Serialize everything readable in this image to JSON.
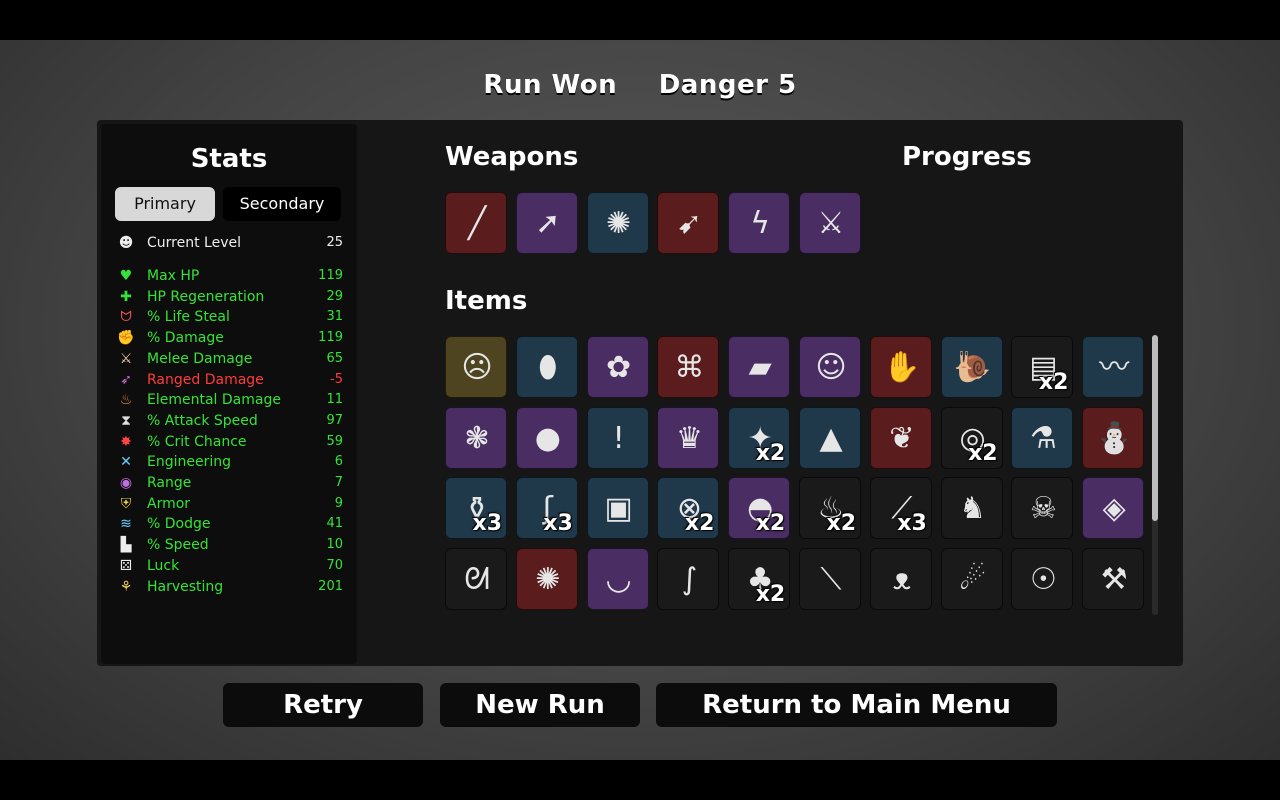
{
  "header": {
    "status": "Run Won",
    "danger": "Danger 5"
  },
  "stats": {
    "title": "Stats",
    "tabs": {
      "primary": "Primary",
      "secondary": "Secondary"
    },
    "level": {
      "label": "Current Level",
      "value": "25"
    },
    "rows": [
      {
        "label": "Max HP",
        "value": "119",
        "color": "#37e237",
        "icon": "heart-icon"
      },
      {
        "label": "HP Regeneration",
        "value": "29",
        "color": "#37e237",
        "icon": "heart-plus-icon"
      },
      {
        "label": "% Life Steal",
        "value": "31",
        "color": "#37e237",
        "icon": "fangs-icon"
      },
      {
        "label": "% Damage",
        "value": "119",
        "color": "#37e237",
        "icon": "muscle-icon"
      },
      {
        "label": "Melee Damage",
        "value": "65",
        "color": "#37e237",
        "icon": "sword-icon"
      },
      {
        "label": "Ranged Damage",
        "value": "-5",
        "color": "#ff3c3c",
        "icon": "bow-icon"
      },
      {
        "label": "Elemental Damage",
        "value": "11",
        "color": "#37e237",
        "icon": "flame-icon"
      },
      {
        "label": "% Attack Speed",
        "value": "97",
        "color": "#37e237",
        "icon": "hourglass-icon"
      },
      {
        "label": "% Crit Chance",
        "value": "59",
        "color": "#37e237",
        "icon": "crit-star-icon"
      },
      {
        "label": "Engineering",
        "value": "6",
        "color": "#37e237",
        "icon": "wrench-icon"
      },
      {
        "label": "Range",
        "value": "7",
        "color": "#37e237",
        "icon": "range-icon"
      },
      {
        "label": "Armor",
        "value": "9",
        "color": "#37e237",
        "icon": "shield-icon"
      },
      {
        "label": "% Dodge",
        "value": "41",
        "color": "#37e237",
        "icon": "dodge-icon"
      },
      {
        "label": "% Speed",
        "value": "10",
        "color": "#37e237",
        "icon": "boot-icon"
      },
      {
        "label": "Luck",
        "value": "70",
        "color": "#37e237",
        "icon": "dice-icon"
      },
      {
        "label": "Harvesting",
        "value": "201",
        "color": "#37e237",
        "icon": "wheat-icon"
      }
    ]
  },
  "weapons": {
    "title": "Weapons",
    "slots": [
      {
        "icon": "stick-icon",
        "tier": "red"
      },
      {
        "icon": "spear-icon",
        "tier": "purple"
      },
      {
        "icon": "saw-icon",
        "tier": "blue"
      },
      {
        "icon": "drill-spear-icon",
        "tier": "red"
      },
      {
        "icon": "lightning-spear-icon",
        "tier": "purple"
      },
      {
        "icon": "sword-icon",
        "tier": "purple"
      }
    ]
  },
  "progress": {
    "title": "Progress"
  },
  "items": {
    "title": "Items",
    "slots": [
      {
        "icon": "egg-face-icon",
        "tier": "gold",
        "count": ""
      },
      {
        "icon": "stone-icon",
        "tier": "blue",
        "count": ""
      },
      {
        "icon": "alien-fly-icon",
        "tier": "purple",
        "count": ""
      },
      {
        "icon": "robot-legs-icon",
        "tier": "red",
        "count": ""
      },
      {
        "icon": "eraser-icon",
        "tier": "purple",
        "count": ""
      },
      {
        "icon": "cat-icon",
        "tier": "purple",
        "count": ""
      },
      {
        "icon": "claw-icon",
        "tier": "red",
        "count": ""
      },
      {
        "icon": "snail-icon",
        "tier": "blue",
        "count": ""
      },
      {
        "icon": "scroll-icon",
        "tier": "black",
        "count": "x2"
      },
      {
        "icon": "leech-icon",
        "tier": "blue",
        "count": ""
      },
      {
        "icon": "peacock-icon",
        "tier": "purple",
        "count": ""
      },
      {
        "icon": "tomato-icon",
        "tier": "purple",
        "count": ""
      },
      {
        "icon": "alert-slime-icon",
        "tier": "blue",
        "count": ""
      },
      {
        "icon": "crown-icon",
        "tier": "purple",
        "count": ""
      },
      {
        "icon": "shard-icon",
        "tier": "blue",
        "count": "x2"
      },
      {
        "icon": "bullet-icon",
        "tier": "blue",
        "count": ""
      },
      {
        "icon": "rainbow-leaf-icon",
        "tier": "red",
        "count": ""
      },
      {
        "icon": "ring-icon",
        "tier": "black",
        "count": "x2"
      },
      {
        "icon": "potion-icon",
        "tier": "blue",
        "count": ""
      },
      {
        "icon": "gnome-icon",
        "tier": "red",
        "count": ""
      },
      {
        "icon": "green-potion-icon",
        "tier": "blue",
        "count": "x3"
      },
      {
        "icon": "tentacle-icon",
        "tier": "blue",
        "count": "x3"
      },
      {
        "icon": "vest-icon",
        "tier": "blue",
        "count": ""
      },
      {
        "icon": "satellite-icon",
        "tier": "blue",
        "count": "x2"
      },
      {
        "icon": "bowler-hat-icon",
        "tier": "purple",
        "count": "x2"
      },
      {
        "icon": "duck-icon",
        "tier": "black",
        "count": "x2"
      },
      {
        "icon": "syringe-icon",
        "tier": "black",
        "count": "x3"
      },
      {
        "icon": "bunny-icon",
        "tier": "black",
        "count": ""
      },
      {
        "icon": "skull-icon",
        "tier": "black",
        "count": ""
      },
      {
        "icon": "orb-icon",
        "tier": "purple",
        "count": ""
      },
      {
        "icon": "ghost-icon",
        "tier": "black",
        "count": ""
      },
      {
        "icon": "octopus-icon",
        "tier": "red",
        "count": ""
      },
      {
        "icon": "mortar-icon",
        "tier": "purple",
        "count": ""
      },
      {
        "icon": "snake-icon",
        "tier": "black",
        "count": ""
      },
      {
        "icon": "palm-icon",
        "tier": "black",
        "count": "x2"
      },
      {
        "icon": "needle-icon",
        "tier": "black",
        "count": ""
      },
      {
        "icon": "bat-icon",
        "tier": "black",
        "count": ""
      },
      {
        "icon": "dynamite-icon",
        "tier": "black",
        "count": ""
      },
      {
        "icon": "mask-icon",
        "tier": "black",
        "count": ""
      },
      {
        "icon": "butcher-icon",
        "tier": "black",
        "count": ""
      }
    ]
  },
  "buttons": {
    "retry": "Retry",
    "new_run": "New Run",
    "main_menu": "Return to Main Menu"
  }
}
